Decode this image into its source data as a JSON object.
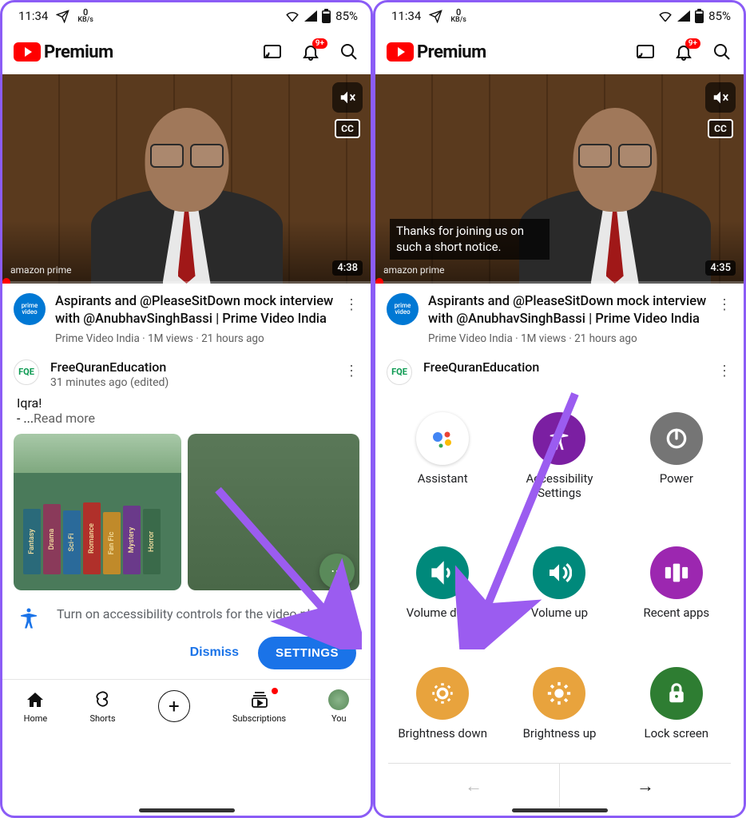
{
  "status": {
    "time": "11:34",
    "net_value": "0",
    "net_unit": "KB/s",
    "battery": "85%"
  },
  "brand": {
    "name": "Premium"
  },
  "notifications": {
    "badge": "9+"
  },
  "video": {
    "watermark": "amazon prime",
    "duration_left": "4:38",
    "duration_right": "4:35",
    "cc": "CC",
    "caption": "Thanks for joining us on such a short notice.",
    "title": "Aspirants and @PleaseSitDown mock interview with @AnubhavSinghBassi | Prime Video India",
    "channel": "Prime Video India",
    "views": "1M views",
    "age": "21 hours ago",
    "avatar_text": "prime video"
  },
  "post": {
    "channel": "FreeQuranEducation",
    "avatar": "FQE",
    "time": "31 minutes ago (edited)",
    "body_line": "Iqra!",
    "body_line2": "- ...",
    "readmore": "Read more",
    "books": [
      "Fantasy",
      "Drama",
      "Sci-Fi",
      "Romance",
      "Fan Fic",
      "Mystery",
      "Horror"
    ]
  },
  "a11y_prompt": {
    "text": "Turn on accessibility controls for the video player?",
    "dismiss": "Dismiss",
    "settings": "SETTINGS"
  },
  "nav": {
    "home": "Home",
    "shorts": "Shorts",
    "subs": "Subscriptions",
    "you": "You"
  },
  "panel": {
    "assistant": "Assistant",
    "a11y": "Accessibility Settings",
    "power": "Power",
    "voldown": "Volume down",
    "volup": "Volume up",
    "recent": "Recent apps",
    "brightdown": "Brightness down",
    "brightup": "Brightness up",
    "lock": "Lock screen"
  }
}
